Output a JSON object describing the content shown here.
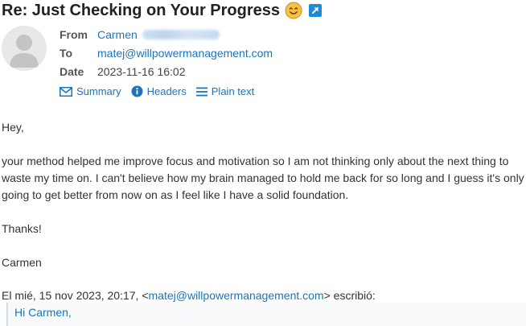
{
  "message": {
    "subject": "Re: Just Checking on Your Progress",
    "subject_emoji": "smiling-face-emoji",
    "popout_icon": "popout-icon"
  },
  "headers": {
    "from_label": "From",
    "from_name": "Carmen",
    "to_label": "To",
    "to_address": "matej@willpowermanagement.com",
    "date_label": "Date",
    "date_value": "2023-11-16 16:02"
  },
  "view_tabs": [
    {
      "label": "Summary",
      "icon": "envelope-icon"
    },
    {
      "label": "Headers",
      "icon": "info-icon"
    },
    {
      "label": "Plain text",
      "icon": "lines-icon"
    }
  ],
  "body": {
    "greeting": "Hey,",
    "paragraph_lines": [
      "your method helped me improve focus and motivation so I am not thinking only about the next thing to",
      "waste my time on. I can't believe how my brain managed to hold me back for so long and I guess it's only",
      "going to get better from now on as I feel like I have a solid foundation."
    ],
    "thanks": "Thanks!",
    "signature": "Carmen"
  },
  "quote": {
    "header_prefix": "El mié, 15 nov 2023, 20:17, <",
    "header_email": "matej@willpowermanagement.com",
    "header_suffix": "> escribió:",
    "first_line": "Hi Carmen,"
  },
  "colors": {
    "link": "#1b75bb",
    "text": "#333333",
    "popout": "#1e8ad6"
  }
}
